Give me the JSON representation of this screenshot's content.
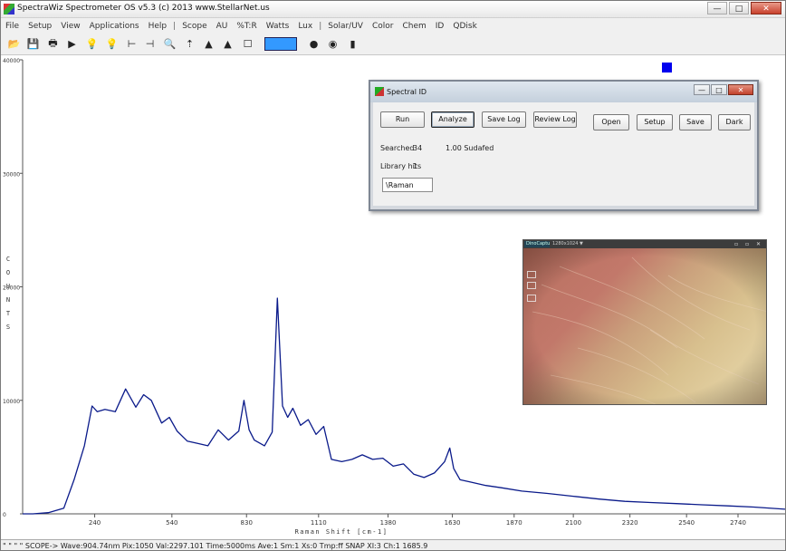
{
  "app": {
    "title": "SpectraWiz Spectrometer OS v5.3 (c) 2013     www.StellarNet.us",
    "window_controls": [
      "—",
      "□",
      "✕"
    ]
  },
  "menu": [
    {
      "label": "File"
    },
    {
      "label": "Setup"
    },
    {
      "label": "View"
    },
    {
      "label": "Applications"
    },
    {
      "label": "Help"
    },
    {
      "label": "|",
      "sep": true
    },
    {
      "label": "Scope"
    },
    {
      "label": "AU"
    },
    {
      "label": "%T:R"
    },
    {
      "label": "Watts"
    },
    {
      "label": "Lux"
    },
    {
      "label": "|",
      "sep": true
    },
    {
      "label": "Solar/UV"
    },
    {
      "label": "Color"
    },
    {
      "label": "Chem"
    },
    {
      "label": "ID"
    },
    {
      "label": "QDisk"
    }
  ],
  "toolbar": [
    {
      "icon": "open-folder-icon",
      "glyph": "📂"
    },
    {
      "icon": "save-icon",
      "glyph": "💾"
    },
    {
      "icon": "print-icon",
      "glyph": "🖶"
    },
    {
      "icon": "run-arrow-icon",
      "glyph": "▶"
    },
    {
      "icon": "lightbulb-dark-icon",
      "glyph": "💡"
    },
    {
      "icon": "lightbulb-bright-icon",
      "glyph": "💡"
    },
    {
      "icon": "cursor-left-icon",
      "glyph": "⊢"
    },
    {
      "icon": "cursor-right-icon",
      "glyph": "⊣"
    },
    {
      "icon": "zoom-icon",
      "glyph": "🔍"
    },
    {
      "icon": "scale-up-icon",
      "glyph": "⇡"
    },
    {
      "icon": "peak-chart-icon",
      "glyph": "▲"
    },
    {
      "icon": "peaks-chart-icon",
      "glyph": "▲"
    },
    {
      "icon": "memo-icon",
      "glyph": "☐"
    },
    {
      "icon": "color-bulb-icon",
      "glyph": "●"
    },
    {
      "icon": "color-wheel-icon",
      "glyph": "◉"
    },
    {
      "icon": "book-icon",
      "glyph": "▮"
    }
  ],
  "toolbar_accent": "#3399ff",
  "chart_data": {
    "type": "line",
    "xlabel": "Raman Shift [cm-1]",
    "ylabel": "COUNTS",
    "xlim": [
      -40,
      2930
    ],
    "ylim": [
      0,
      40000
    ],
    "x_ticks": [
      "240",
      "540",
      "830",
      "1110",
      "1380",
      "1630",
      "1870",
      "2100",
      "2320",
      "2540",
      "2740"
    ],
    "y_ticks": [
      "0",
      "10000",
      "20000",
      "30000",
      "40000"
    ],
    "series_color": "#0a1a8a",
    "series": [
      {
        "x": [
          -40,
          0,
          60,
          120,
          160,
          200,
          230,
          250,
          280,
          320,
          360,
          400,
          430,
          460,
          500,
          530,
          560,
          600,
          640,
          680,
          720,
          760,
          800,
          820,
          840,
          860,
          900,
          930,
          950,
          970,
          990,
          1010,
          1040,
          1070,
          1100,
          1130,
          1160,
          1200,
          1240,
          1280,
          1320,
          1360,
          1400,
          1440,
          1480,
          1520,
          1560,
          1600,
          1620,
          1635,
          1660,
          1700,
          1760,
          1820,
          1900,
          2000,
          2100,
          2200,
          2300,
          2400,
          2500,
          2600,
          2700,
          2800,
          2930
        ],
        "y": [
          0,
          0,
          100,
          500,
          3000,
          6000,
          9500,
          9000,
          9200,
          9000,
          11000,
          9400,
          10500,
          10000,
          8000,
          8500,
          7300,
          6400,
          6200,
          6000,
          7400,
          6500,
          7300,
          10000,
          7400,
          6500,
          6000,
          7200,
          19000,
          9500,
          8500,
          9300,
          7800,
          8300,
          7000,
          7700,
          4800,
          4600,
          4800,
          5200,
          4800,
          4900,
          4200,
          4400,
          3500,
          3200,
          3600,
          4600,
          5800,
          4000,
          3000,
          2800,
          2500,
          2300,
          2000,
          1800,
          1550,
          1300,
          1100,
          1000,
          900,
          800,
          700,
          600,
          400
        ]
      }
    ]
  },
  "dialog": {
    "title": "Spectral ID",
    "controls": [
      "—",
      "□",
      "✕"
    ],
    "buttons": {
      "run": "Run",
      "analyze": "Analyze",
      "save_log": "Save Log",
      "review_log": "Review Log",
      "open": "Open",
      "setup": "Setup",
      "save": "Save",
      "dark": "Dark"
    },
    "searched_label": "Searched",
    "searched_value": "34",
    "result": "1.00 Sudafed",
    "library_hits_label": "Library hits",
    "library_hits_value": "1",
    "library_input": "\\Raman"
  },
  "camera": {
    "tab": "DinoCapture",
    "resolution": "1280x1024 ▼",
    "controls": "▫ ▫ ✕"
  },
  "status": "\" \" \" \" SCOPE->     Wave:904.74nm  Pix:1050  Val:2297.101  Time:5000ms  Ave:1  Sm:1  Xs:0  Tmp:ff  SNAP  XI:3  Ch:1      1685.9"
}
